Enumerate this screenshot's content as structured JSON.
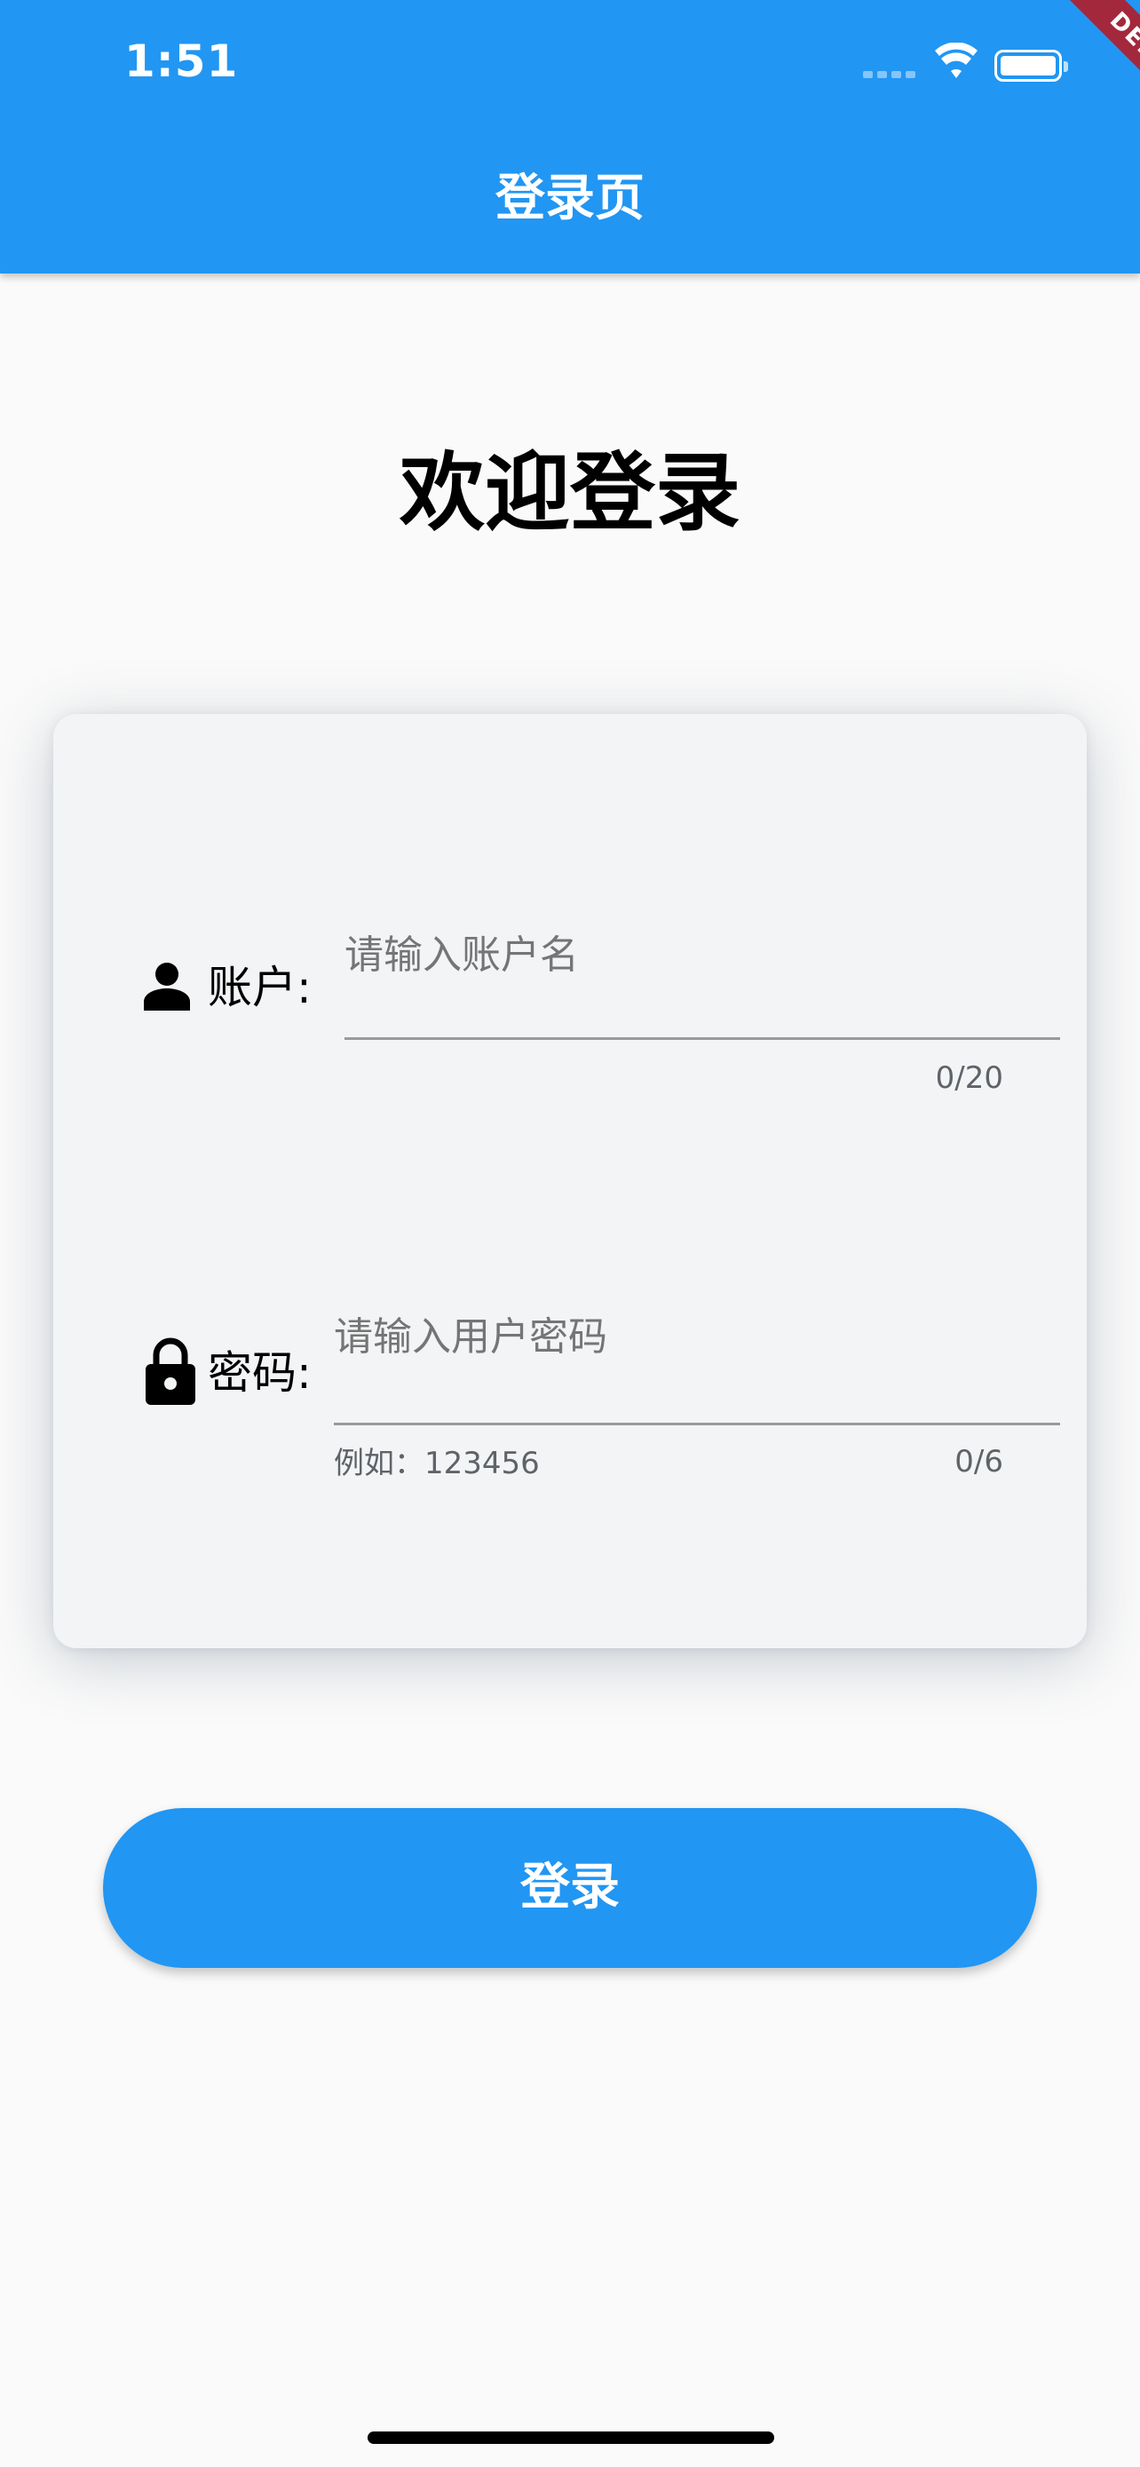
{
  "status_bar": {
    "time": "1:51"
  },
  "debug_banner": "DEBUG",
  "app_bar": {
    "title": "登录页"
  },
  "welcome_title": "欢迎登录",
  "account": {
    "label": "账户:",
    "placeholder": "请输入账户名",
    "value": "",
    "counter": "0/20",
    "icon": "person-icon"
  },
  "password": {
    "label": "密码:",
    "placeholder": "请输入用户密码",
    "value": "",
    "helper": "例如：123456",
    "counter": "0/6",
    "icon": "lock-icon"
  },
  "login_button": "登录",
  "colors": {
    "primary": "#2196f3",
    "debug": "#a4283c",
    "card_bg": "#f2f4f6",
    "page_bg": "#fafafa"
  }
}
